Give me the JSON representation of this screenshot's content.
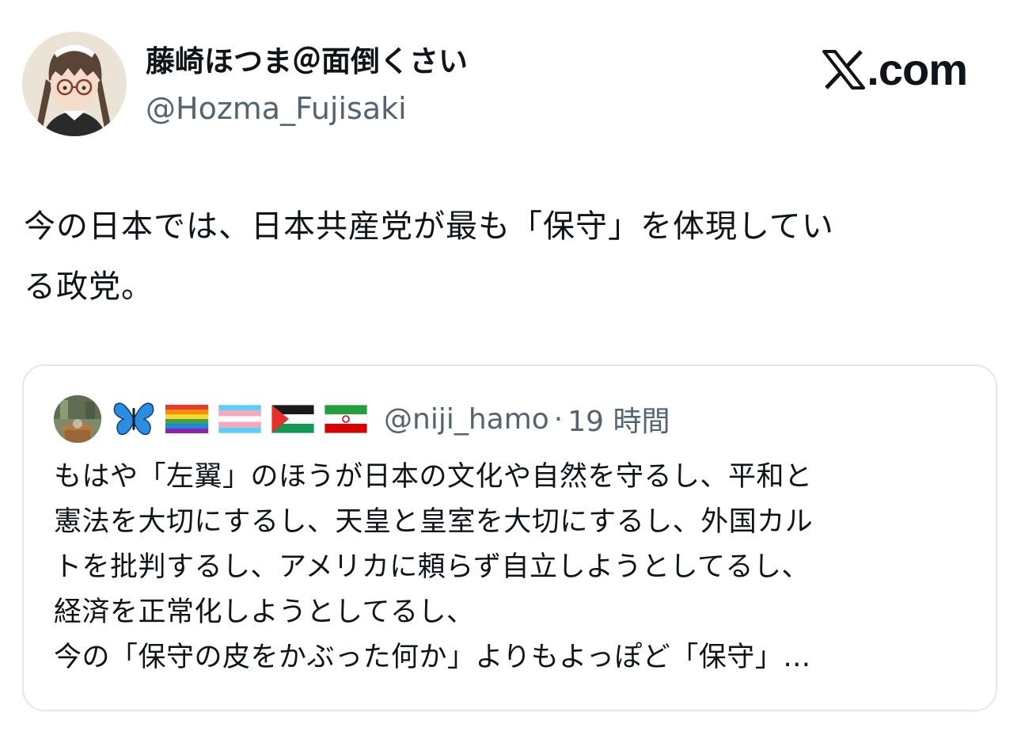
{
  "author": {
    "display_name": "藤崎ほつま＠面倒くさい",
    "handle": "@Hozma_Fujisaki",
    "avatar_icon": "profile-avatar"
  },
  "brand": {
    "text": ".com",
    "icon": "x-logo-icon"
  },
  "tweet": {
    "lines": [
      "今の日本では、日本共産党が最も「保守」を体現してい",
      "る政党。"
    ]
  },
  "quoted": {
    "avatar_icon": "quoted-avatar",
    "emoji_icons": [
      "butterfly-icon",
      "rainbow-flag-icon",
      "transgender-flag-icon",
      "palestine-flag-icon",
      "iran-flag-icon"
    ],
    "handle": "@niji_hamo",
    "separator": "·",
    "time": "19 時間",
    "lines": [
      "もはや「左翼」のほうが日本の文化や自然を守るし、平和と",
      "憲法を大切にするし、天皇と皇室を大切にするし、外国カル",
      "トを批判するし、アメリカに頼らず自立しようとしてるし、",
      "経済を正常化しようとしてるし、",
      "今の「保守の皮をかぶった何か」よりもよっぽど「保守」…"
    ]
  },
  "colors": {
    "text": "#0f1419",
    "secondary": "#536471",
    "border": "#e3e7ea"
  }
}
